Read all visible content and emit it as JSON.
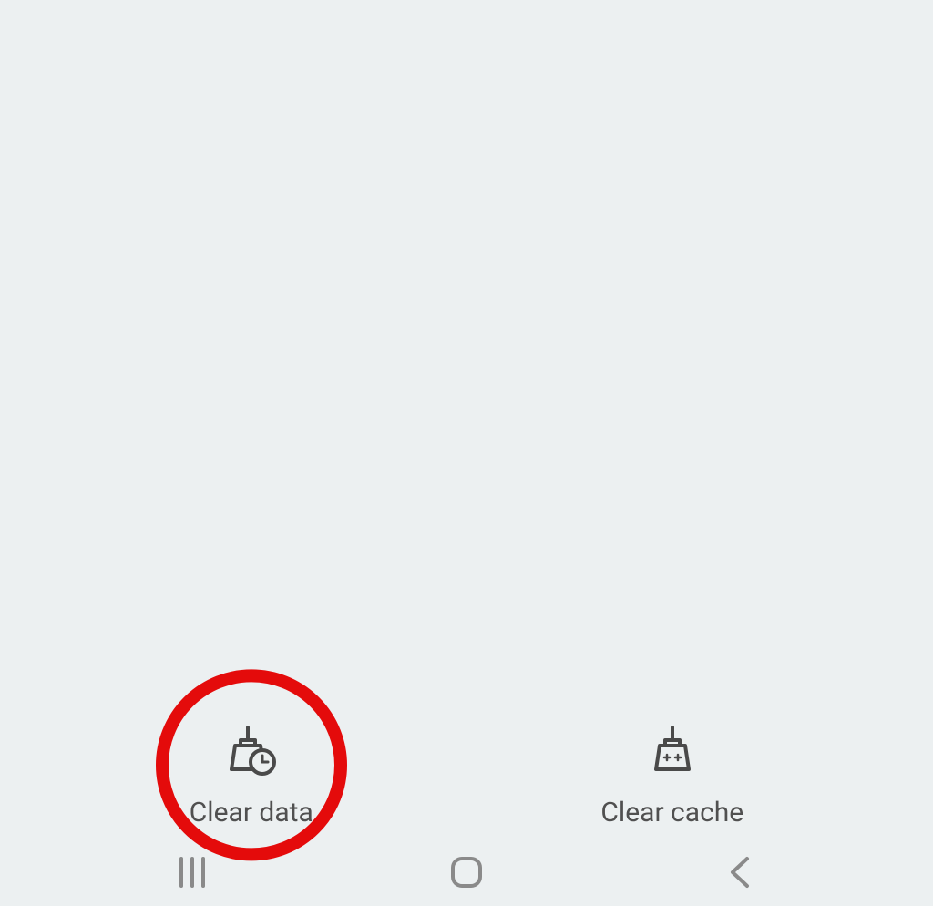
{
  "actions": {
    "clear_data": {
      "label": "Clear data"
    },
    "clear_cache": {
      "label": "Clear cache"
    }
  },
  "highlight_color": "#e40b0b",
  "icon_color": "#4a4a4a"
}
